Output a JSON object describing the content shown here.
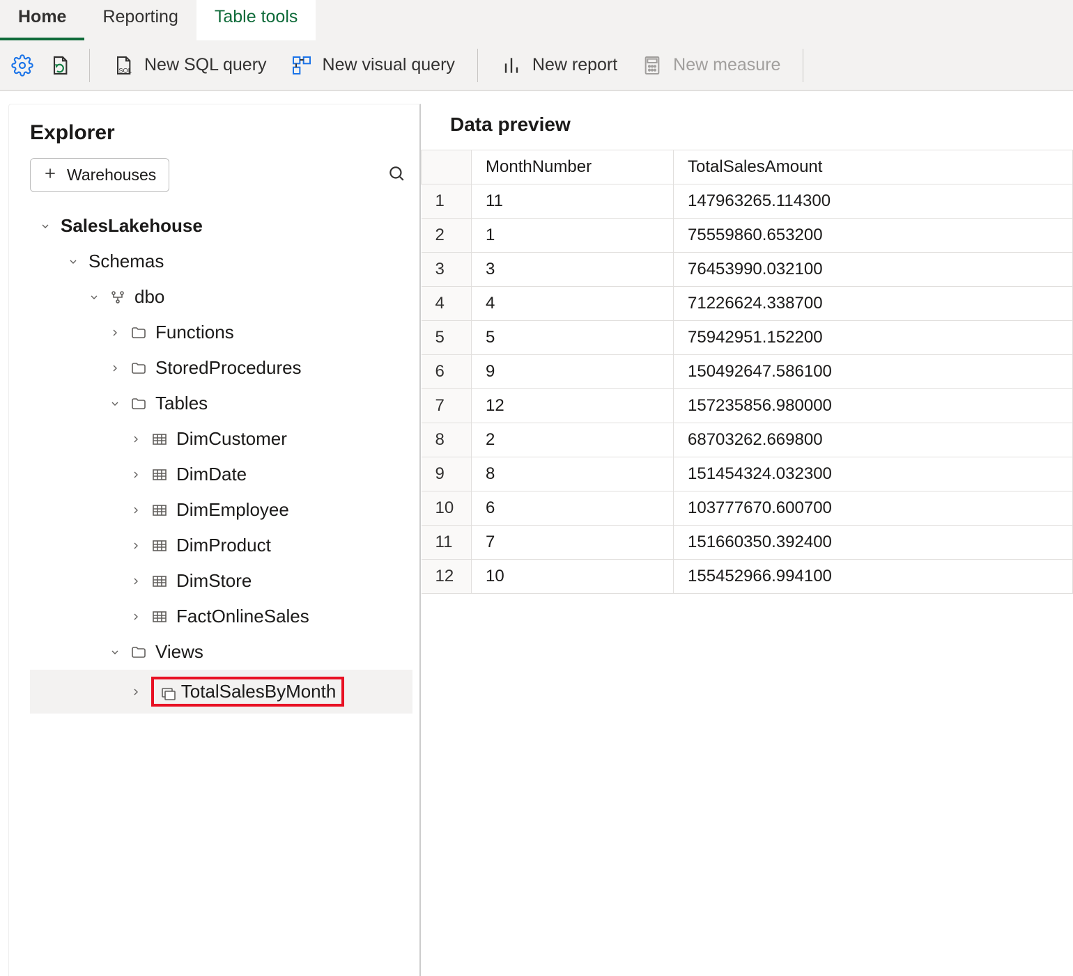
{
  "tabs": [
    {
      "label": "Home",
      "state": "home"
    },
    {
      "label": "Reporting",
      "state": ""
    },
    {
      "label": "Table tools",
      "state": "active"
    }
  ],
  "toolbar": {
    "new_sql": "New SQL query",
    "new_visual": "New visual query",
    "new_report": "New report",
    "new_measure": "New measure"
  },
  "explorer": {
    "title": "Explorer",
    "warehouses_btn": "Warehouses",
    "tree": {
      "lakehouse": "SalesLakehouse",
      "schemas": "Schemas",
      "dbo": "dbo",
      "functions": "Functions",
      "stored": "StoredProcedures",
      "tables_label": "Tables",
      "tables": [
        "DimCustomer",
        "DimDate",
        "DimEmployee",
        "DimProduct",
        "DimStore",
        "FactOnlineSales"
      ],
      "views_label": "Views",
      "selected_view": "TotalSalesByMonth"
    }
  },
  "preview": {
    "title": "Data preview",
    "columns": [
      "MonthNumber",
      "TotalSalesAmount"
    ],
    "rows": [
      {
        "n": "1",
        "month": "11",
        "amount": "147963265.114300"
      },
      {
        "n": "2",
        "month": "1",
        "amount": "75559860.653200"
      },
      {
        "n": "3",
        "month": "3",
        "amount": "76453990.032100"
      },
      {
        "n": "4",
        "month": "4",
        "amount": "71226624.338700"
      },
      {
        "n": "5",
        "month": "5",
        "amount": "75942951.152200"
      },
      {
        "n": "6",
        "month": "9",
        "amount": "150492647.586100"
      },
      {
        "n": "7",
        "month": "12",
        "amount": "157235856.980000"
      },
      {
        "n": "8",
        "month": "2",
        "amount": "68703262.669800"
      },
      {
        "n": "9",
        "month": "8",
        "amount": "151454324.032300"
      },
      {
        "n": "10",
        "month": "6",
        "amount": "103777670.600700"
      },
      {
        "n": "11",
        "month": "7",
        "amount": "151660350.392400"
      },
      {
        "n": "12",
        "month": "10",
        "amount": "155452966.994100"
      }
    ]
  }
}
